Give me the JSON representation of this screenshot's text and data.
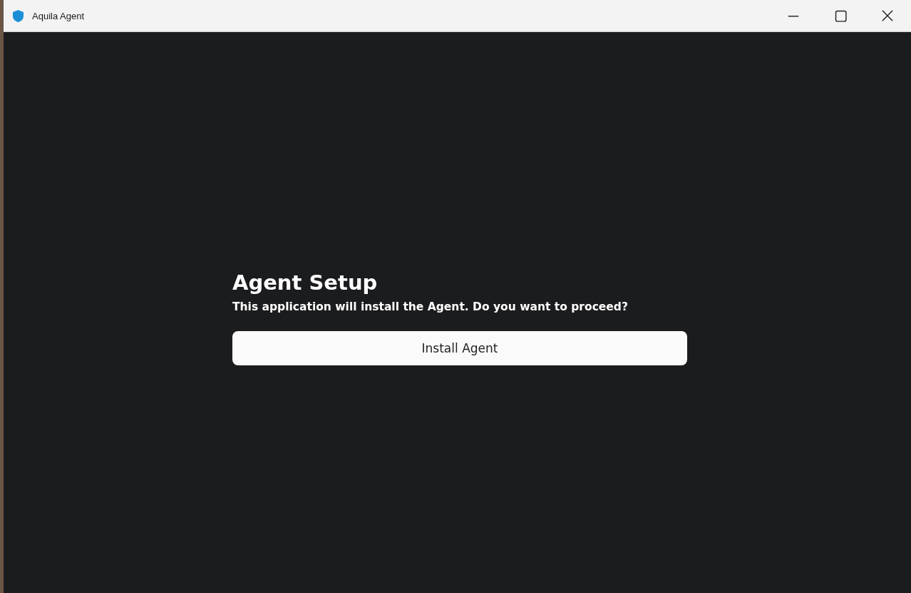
{
  "window": {
    "title": "Aquila Agent"
  },
  "setup": {
    "heading": "Agent Setup",
    "message": "This application will install the Agent. Do you want to proceed?",
    "button": "Install Agent"
  }
}
